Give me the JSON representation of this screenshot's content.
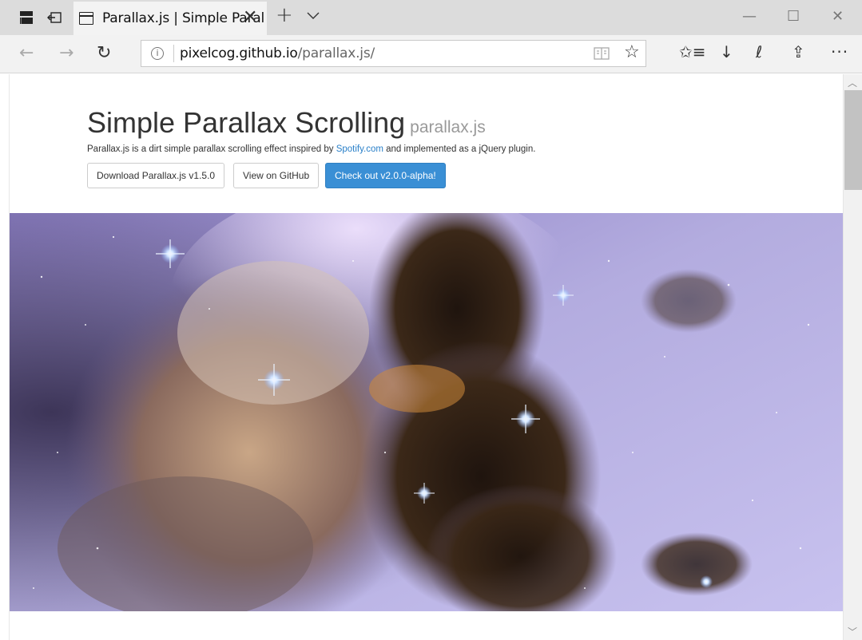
{
  "browser": {
    "tab": {
      "title": "Parallax.js | Simple Paral",
      "close_glyph": "✕"
    },
    "new_tab_glyph": "+",
    "tab_list_icon": "chevron-down-icon",
    "window_controls": {
      "minimize": "—",
      "maximize": "☐",
      "close": "✕"
    },
    "nav": {
      "back": "←",
      "forward": "→",
      "refresh": "↻"
    },
    "address": {
      "info_glyph": "i",
      "host": "pixelcog.github.io",
      "path": "/parallax.js/"
    },
    "toolbar": {
      "favorites_glyph": "☆",
      "hub_glyph": "✩≡",
      "download_glyph": "↓",
      "notes_glyph": "ℓ",
      "share_glyph": "⇪",
      "more_glyph": "···"
    }
  },
  "page": {
    "title": "Simple Parallax Scrolling",
    "title_sub": "parallax.js",
    "lead_before": "Parallax.js is a dirt simple parallax scrolling effect inspired by ",
    "lead_link": "Spotify.com",
    "lead_after": " and implemented as a jQuery plugin.",
    "buttons": {
      "download": "Download Parallax.js v1.5.0",
      "github": "View on GitHub",
      "alpha": "Check out v2.0.0-alpha!"
    }
  },
  "scrollbar": {
    "up_glyph": "︿",
    "down_glyph": "﹀"
  },
  "colors": {
    "accent": "#3a8fd5",
    "link": "#2a80c9",
    "nebula_sky": "#b7b3e8",
    "nebula_dust": "#3a2a1e"
  }
}
